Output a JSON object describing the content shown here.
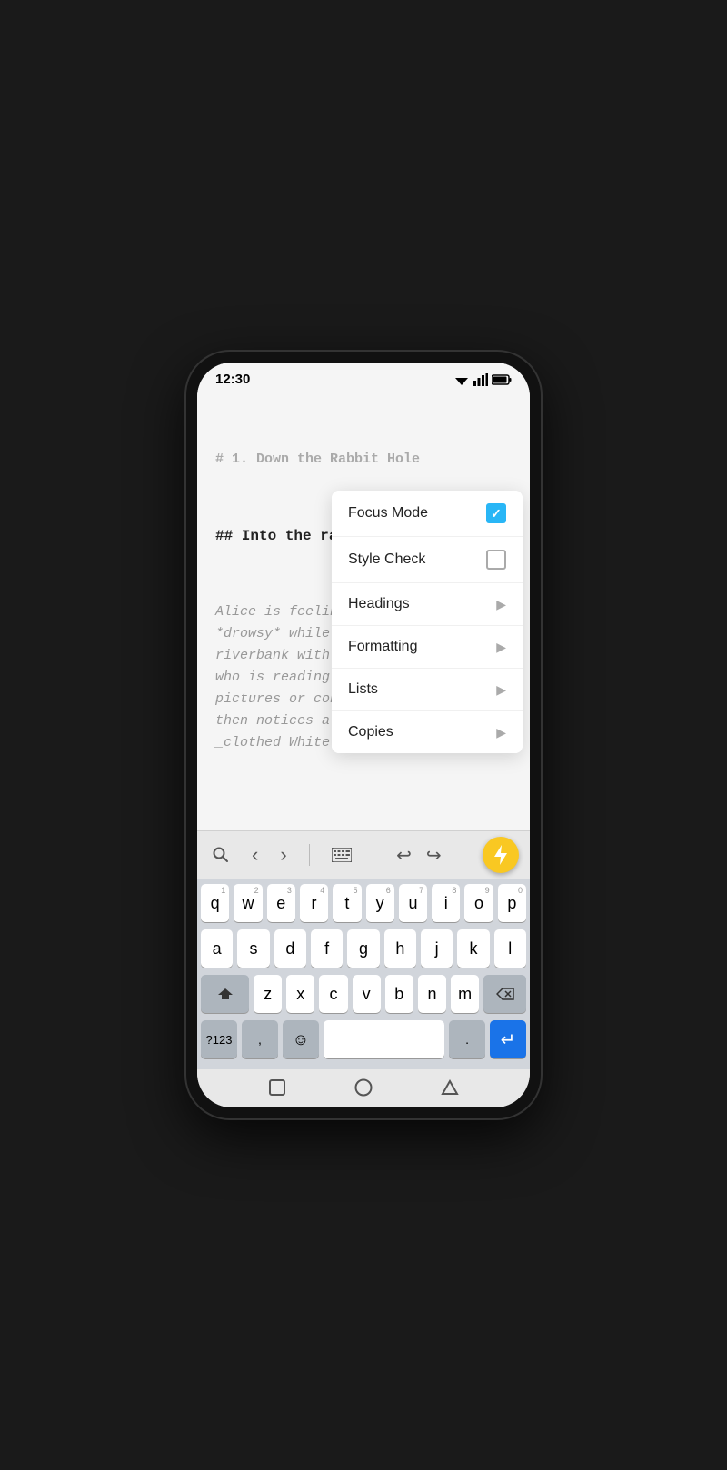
{
  "statusBar": {
    "time": "12:30",
    "wifi": "wifi-icon",
    "signal": "signal-icon",
    "battery": "battery-icon"
  },
  "editor": {
    "heading1": "# 1. Down the Rabbit Hole",
    "heading2": "## Into the rabbit",
    "bodyText": "Alice is feeling bo\n*drowsy* while sitt\nriverbank with her \nwho is reading a bo\npictures or convers\nthen notices a tall\n_clothed White Rabb"
  },
  "contextMenu": {
    "items": [
      {
        "id": "focus-mode",
        "label": "Focus Mode",
        "type": "checkbox",
        "checked": true
      },
      {
        "id": "style-check",
        "label": "Style Check",
        "type": "checkbox",
        "checked": false
      },
      {
        "id": "headings",
        "label": "Headings",
        "type": "submenu"
      },
      {
        "id": "formatting",
        "label": "Formatting",
        "type": "submenu"
      },
      {
        "id": "lists",
        "label": "Lists",
        "type": "submenu"
      },
      {
        "id": "copies",
        "label": "Copies",
        "type": "submenu"
      }
    ]
  },
  "toolbar": {
    "searchLabel": "🔍",
    "backLabel": "‹",
    "forwardLabel": "›",
    "keyboardLabel": "⌨",
    "undoLabel": "↩",
    "redoLabel": "↪",
    "fabLabel": "⚡"
  },
  "keyboard": {
    "row1": [
      "q",
      "w",
      "e",
      "r",
      "t",
      "y",
      "u",
      "i",
      "o",
      "p"
    ],
    "row1nums": [
      "1",
      "2",
      "3",
      "4",
      "5",
      "6",
      "7",
      "8",
      "9",
      "0"
    ],
    "row2": [
      "a",
      "s",
      "d",
      "f",
      "g",
      "h",
      "j",
      "k",
      "l"
    ],
    "row3": [
      "z",
      "x",
      "c",
      "v",
      "b",
      "n",
      "m"
    ],
    "specials": {
      "symbols": "?123",
      "comma": ",",
      "emoji": "☺",
      "space": " ",
      "period": ".",
      "enter": "↵"
    }
  },
  "navBar": {
    "square": "square-icon",
    "circle": "circle-icon",
    "triangle": "triangle-icon"
  }
}
